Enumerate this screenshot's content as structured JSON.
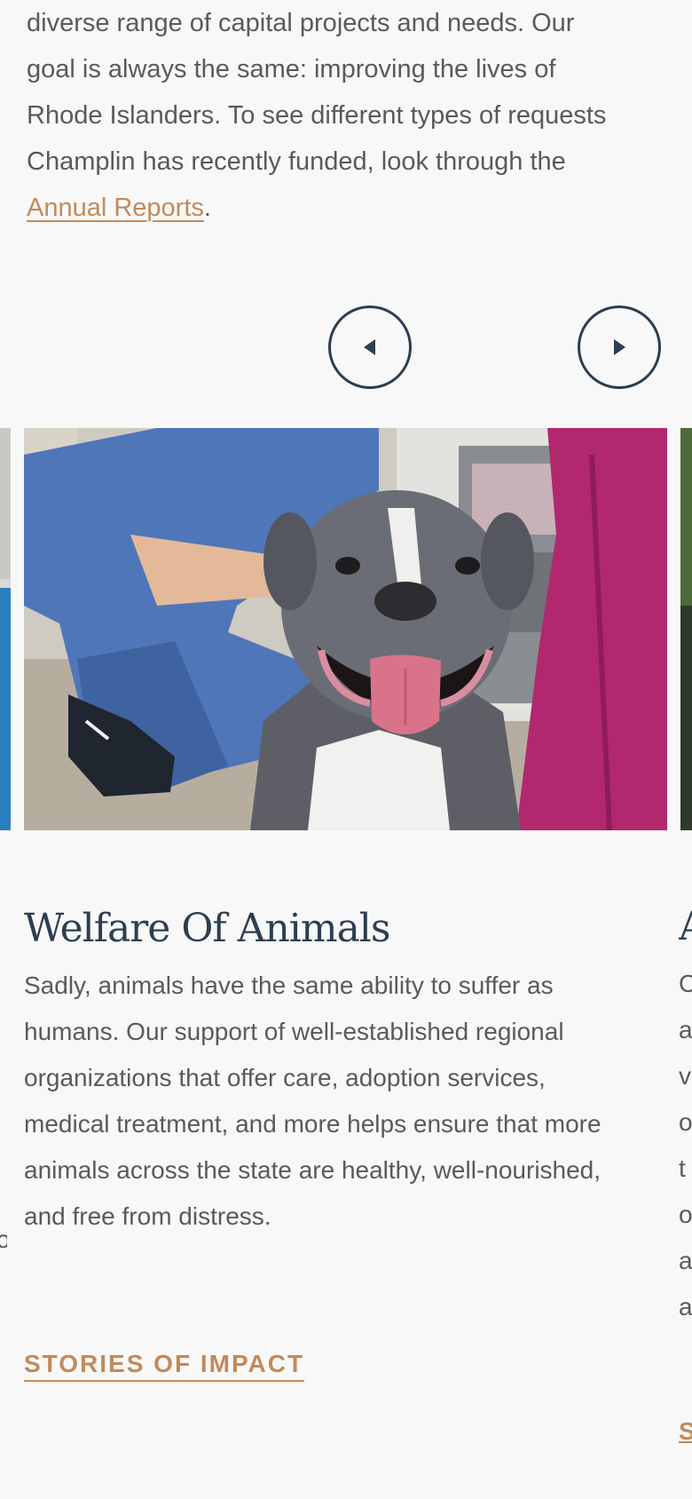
{
  "intro": {
    "lines": [
      "diverse range of capital projects and needs. Our",
      "goal is always the same: improving the lives of",
      "Rhode Islanders. To see different types of requests",
      "Champlin has recently funded, look through the"
    ],
    "link_text": "Annual Reports",
    "after_link": "."
  },
  "carousel": {
    "prev_icon": "caret-left-icon",
    "next_icon": "caret-right-icon",
    "border_color": "#2c3e50"
  },
  "slide": {
    "image_alt": "Smiling grey pit bull dog with a veterinary staff member",
    "title": "Welfare Of Animals",
    "body_lines": [
      "Sadly, animals have the same ability to suffer as",
      "humans. Our support of well-established regional",
      "organizations that offer care, adoption services,",
      "medical treatment, and more helps ensure that more",
      "animals across the state are healthy, well-nourished,",
      "and free from distress."
    ],
    "link_label": "STORIES OF IMPACT"
  },
  "peek": {
    "title_char": "A",
    "chars": [
      "C",
      "a",
      "v",
      "o",
      "t",
      "o",
      "a",
      "a"
    ],
    "link_char": "S",
    "prev_char": "o"
  },
  "colors": {
    "accent": "#c28a5a",
    "heading": "#2c3e50",
    "body_text": "#5a5a5a",
    "background": "#f8f8f8"
  }
}
